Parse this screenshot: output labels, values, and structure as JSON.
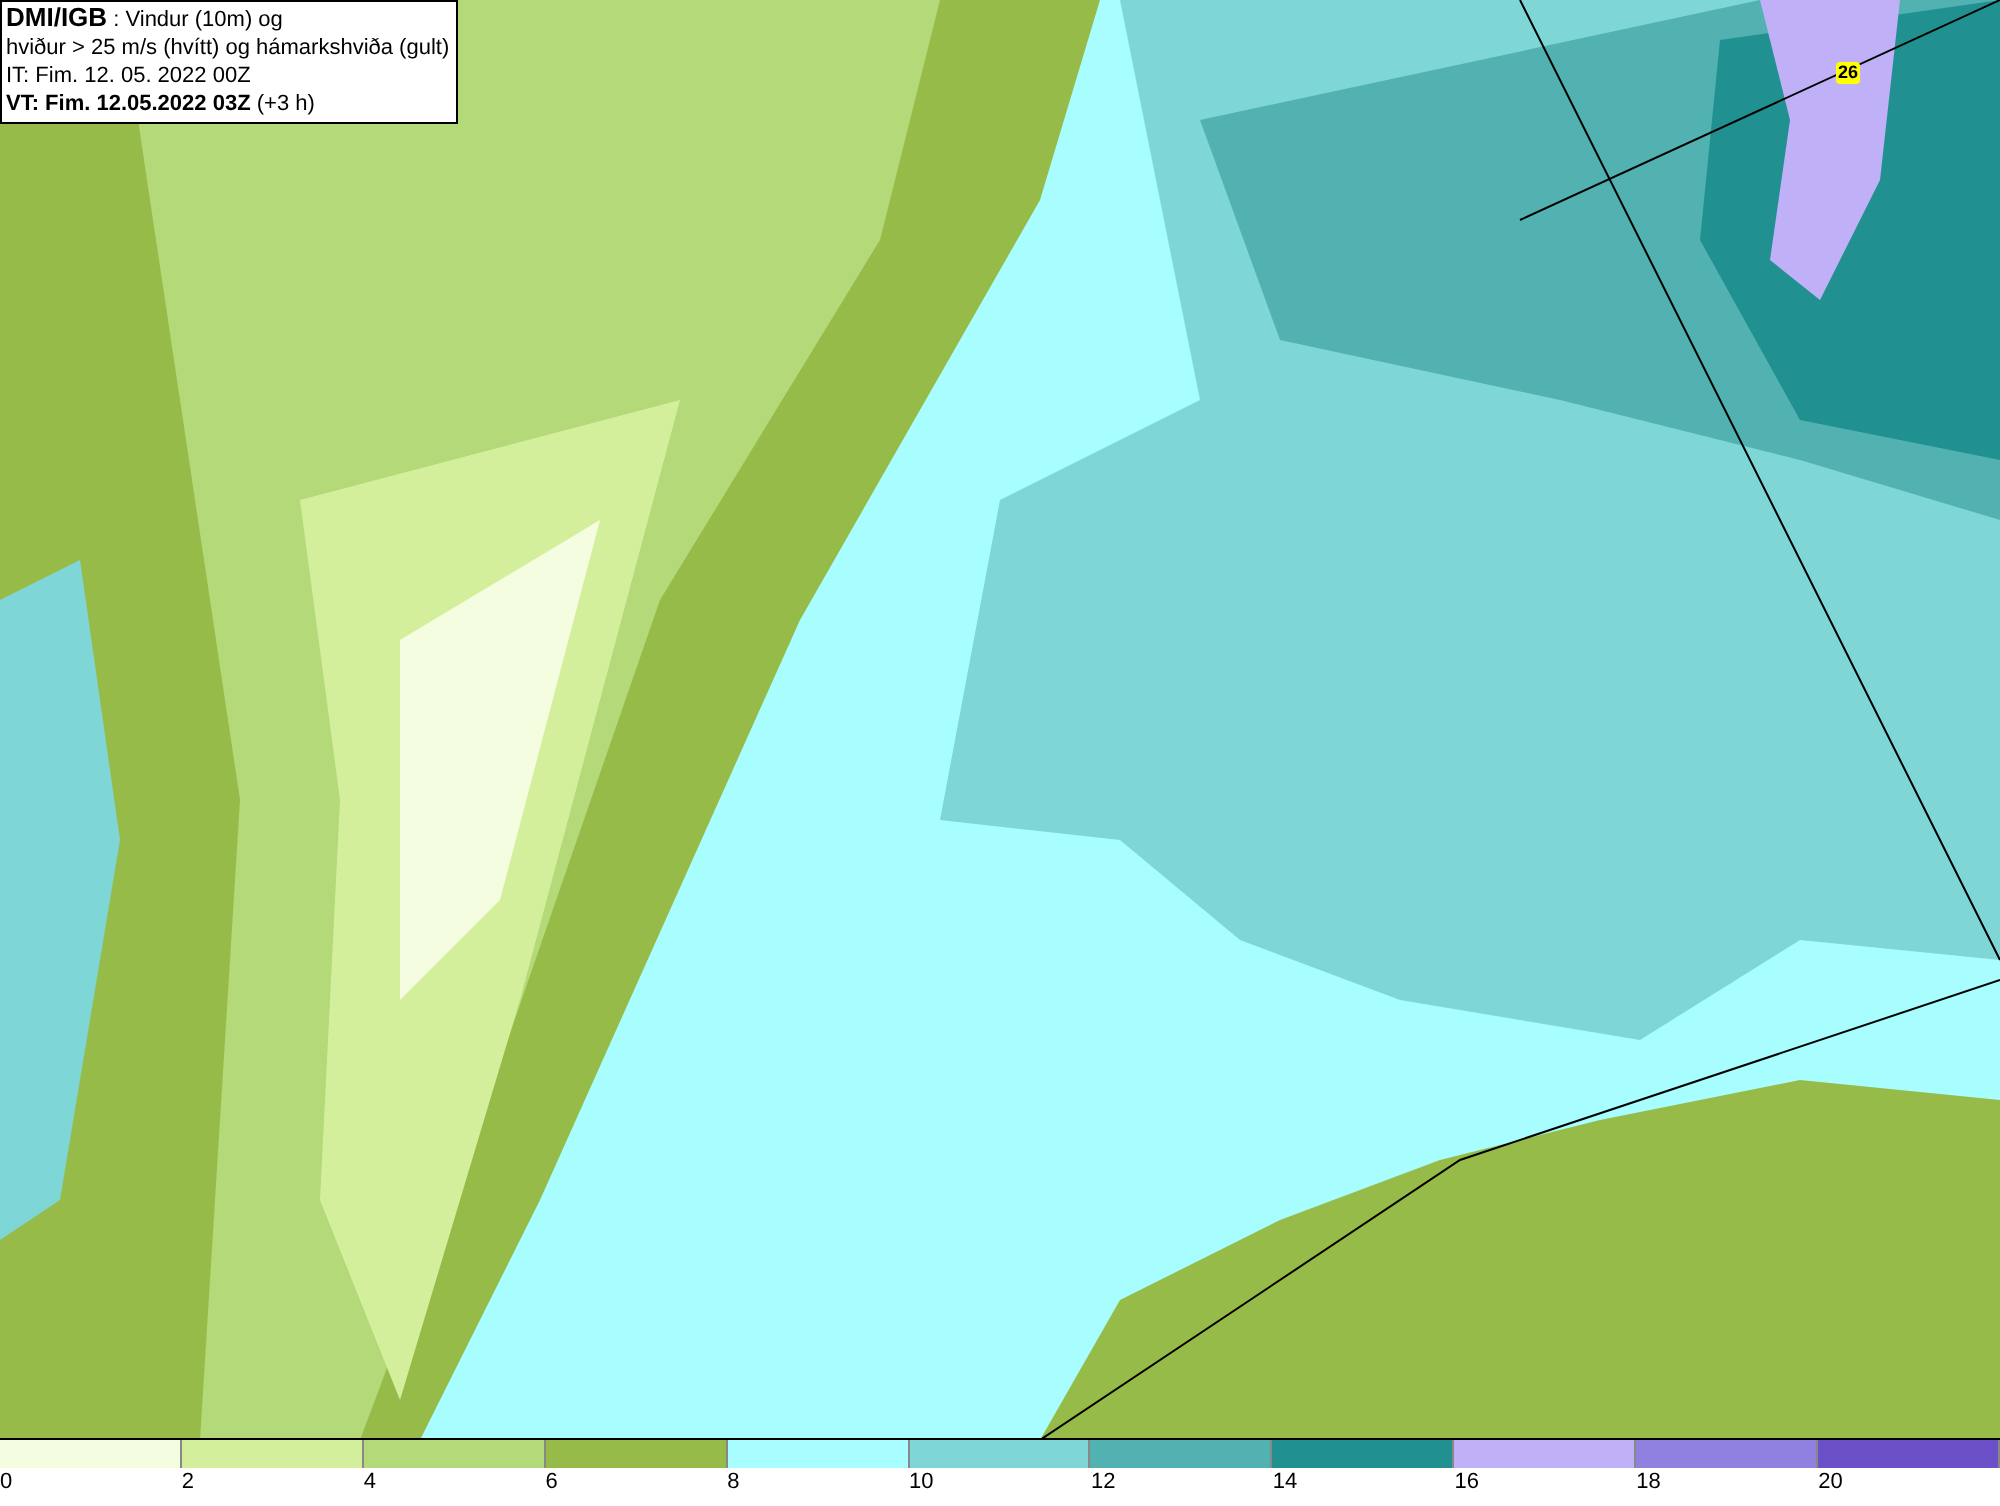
{
  "info_box": {
    "source": "DMI/IGB",
    "title_rest": " : Vindur (10m) og",
    "line_2": "hviður > 25 m/s (hvítt) og hámarkshviða (gult)",
    "issue_time": "IT: Fim. 12. 05. 2022 00Z",
    "valid_time": "VT: Fim. 12.05.2022 03Z",
    "lead": " (+3 h)"
  },
  "map": {
    "gust_marker": "26"
  },
  "legend": [
    {
      "label": "0",
      "color": "#f5fde0"
    },
    {
      "label": "2",
      "color": "#d4ef9c"
    },
    {
      "label": "4",
      "color": "#b4d978"
    },
    {
      "label": "6",
      "color": "#97bb48"
    },
    {
      "label": "8",
      "color": "#a8fefe"
    },
    {
      "label": "10",
      "color": "#7fd6d6"
    },
    {
      "label": "12",
      "color": "#52b2b2"
    },
    {
      "label": "14",
      "color": "#219090"
    },
    {
      "label": "16",
      "color": "#c0b0f8"
    },
    {
      "label": "18",
      "color": "#9080e0"
    },
    {
      "label": "20",
      "color": "#6c50c8"
    }
  ]
}
